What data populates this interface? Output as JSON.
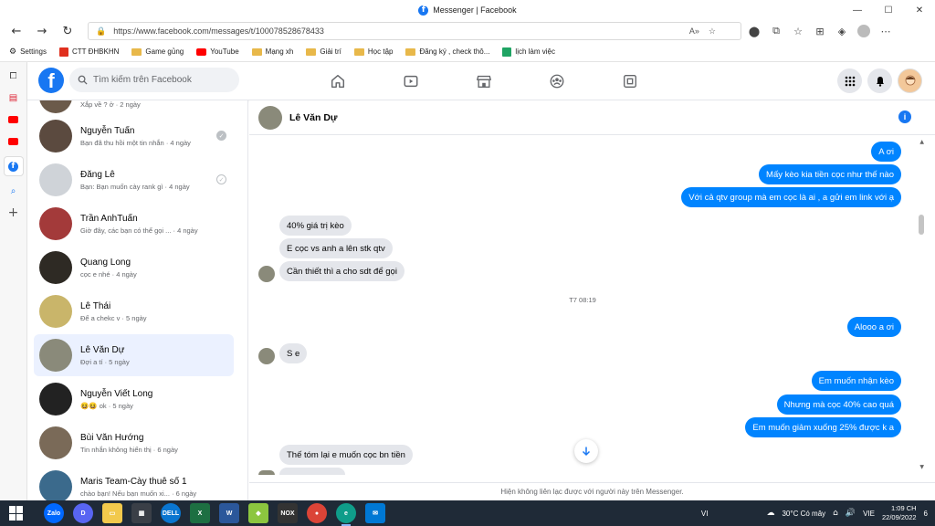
{
  "window": {
    "title": "Messenger | Facebook",
    "minimize": "—",
    "maximize": "☐",
    "close": "✕"
  },
  "browser": {
    "url": "https://www.facebook.com/messages/t/100078528678433",
    "bookmarks": [
      {
        "label": "Settings"
      },
      {
        "label": "CTT ĐHBKHN"
      },
      {
        "label": "Game gủng"
      },
      {
        "label": "YouTube"
      },
      {
        "label": "Mạng xh"
      },
      {
        "label": "Giải trí"
      },
      {
        "label": "Học tập"
      },
      {
        "label": "Đăng ký , check thô..."
      },
      {
        "label": "lịch làm việc"
      }
    ]
  },
  "facebook": {
    "logo": "f",
    "search_placeholder": "Tìm kiếm trên Facebook"
  },
  "chats": {
    "top_partial_snippet": "Xắp về ? ở · 2 ngày",
    "items": [
      {
        "name": "Nguyễn Tuấn",
        "snippet": "Bạn đã thu hồi một tin nhắn · 4 ngày",
        "seen": "filled",
        "avatar_color": "#5b4a3f"
      },
      {
        "name": "Đăng Lê",
        "snippet": "Bạn: Bạn muốn cày rank gì · 4 ngày",
        "seen": "outline",
        "avatar_color": "#cfd3d8"
      },
      {
        "name": "Trần AnhTuấn",
        "snippet": "Giờ đây, các bạn có thể gọi ... · 4 ngày",
        "seen": "",
        "avatar_color": "#a33a3a"
      },
      {
        "name": "Quang Long",
        "snippet": "cọc e nhé · 4 ngày",
        "seen": "",
        "avatar_color": "#2e2a24"
      },
      {
        "name": "Lê Thái",
        "snippet": "Để a chekc v · 5 ngày",
        "seen": "",
        "avatar_color": "#c9b56a"
      },
      {
        "name": "Lê Văn Dự",
        "snippet": "Đợi a tí · 5 ngày",
        "seen": "",
        "avatar_color": "#8a8a7a",
        "active": true
      },
      {
        "name": "Nguyễn Viết Long",
        "snippet": "😆😆 ok · 5 ngày",
        "seen": "",
        "avatar_color": "#222222"
      },
      {
        "name": "Bùi Văn Hướng",
        "snippet": "Tin nhắn không hiển thị · 6 ngày",
        "seen": "",
        "avatar_color": "#7a6a58"
      },
      {
        "name": "Maris Team-Cày thuê số 1",
        "snippet": "chào bạn! Nếu bạn muốn xi... · 6 ngày",
        "seen": "",
        "avatar_color": "#3b6a8c"
      }
    ]
  },
  "conversation": {
    "contact_name": "Lê Văn Dự",
    "messages": [
      {
        "dir": "out",
        "text": "A ơi"
      },
      {
        "dir": "out",
        "text": "Mấy kèo kia tiền cọc như thế nào"
      },
      {
        "dir": "out",
        "text": "Với cả qtv group mà em cọc là ai , a gửi em link với ạ"
      },
      {
        "dir": "in",
        "text": "40% giá trị kèo"
      },
      {
        "dir": "in",
        "text": "E cọc vs anh a lên stk qtv"
      },
      {
        "dir": "in",
        "text": "Cần thiết thì a cho sdt để gọi"
      },
      {
        "dir": "out",
        "text": "Alooo a ơi"
      },
      {
        "dir": "in",
        "text": "S e"
      },
      {
        "dir": "out",
        "text": "Em muốn nhận kèo"
      },
      {
        "dir": "out",
        "text": "Nhưng mà cọc 40% cao quá"
      },
      {
        "dir": "out",
        "text": "Em muốn giảm xuống 25% được k a"
      },
      {
        "dir": "in",
        "text": "Thế tóm lại e muốn cọc bn tiền"
      }
    ],
    "timestamp": "T7 08:19",
    "footer": "Hiện không liên lạc được với người này trên Messenger."
  },
  "taskbar": {
    "weather": "30°C  Có mây",
    "lang": "VIE",
    "time": "1:09 CH",
    "date": "22/09/2022",
    "notif_count": "6",
    "vi_label": "VI"
  },
  "colors": {
    "messenger_blue": "#0084ff",
    "fb_blue": "#1877f2",
    "active_row": "#ebf1ff"
  }
}
